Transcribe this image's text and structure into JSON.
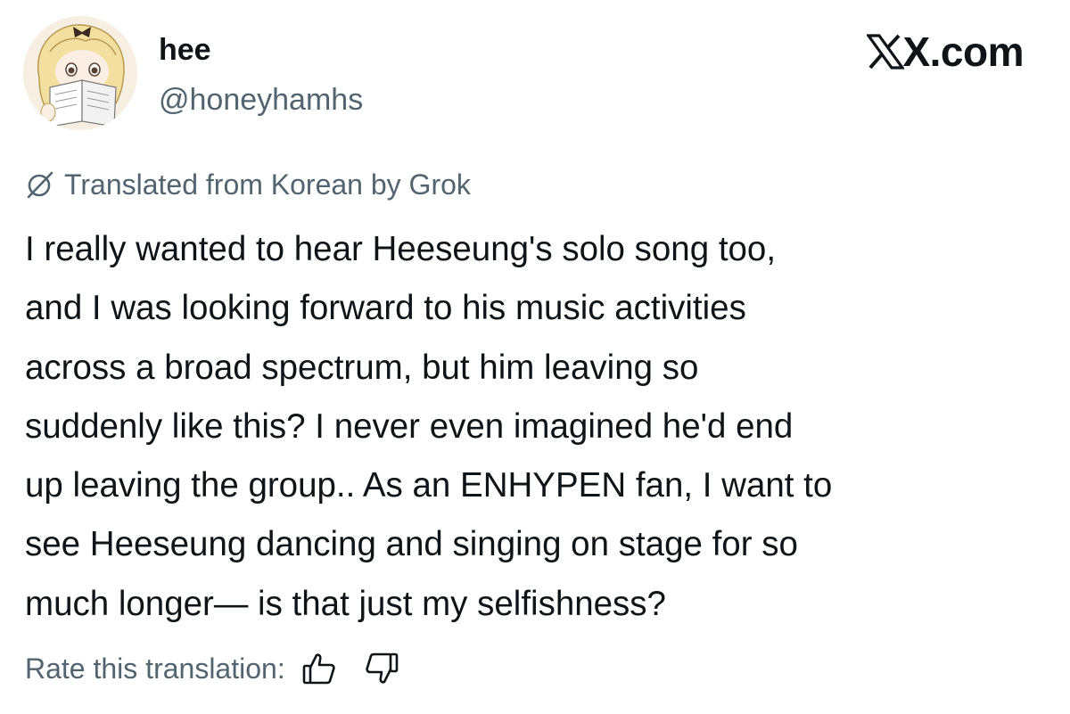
{
  "author": {
    "display_name": "hee",
    "handle": "@honeyhamhs",
    "avatar_icon": "anime-girl-reading-avatar"
  },
  "brand": {
    "label": "X.com",
    "icon": "x-logo"
  },
  "translation": {
    "note": "Translated from Korean by Grok",
    "icon": "grok-icon"
  },
  "post": {
    "lines": [
      "I really wanted to hear Heeseung's solo song too,",
      "and I was looking forward to his music activities",
      "across a broad spectrum, but him leaving so",
      "suddenly like this? I never even imagined he'd end",
      "up leaving the group.. As an ENHYPEN fan, I want to",
      "see Heeseung dancing and singing on stage for so",
      "much longer— is that just my selfishness?"
    ]
  },
  "rating": {
    "label": "Rate this translation:",
    "up_icon": "thumbs-up-icon",
    "down_icon": "thumbs-down-icon"
  },
  "colors": {
    "text_primary": "#0f1419",
    "text_secondary": "#536471",
    "background": "#ffffff"
  }
}
